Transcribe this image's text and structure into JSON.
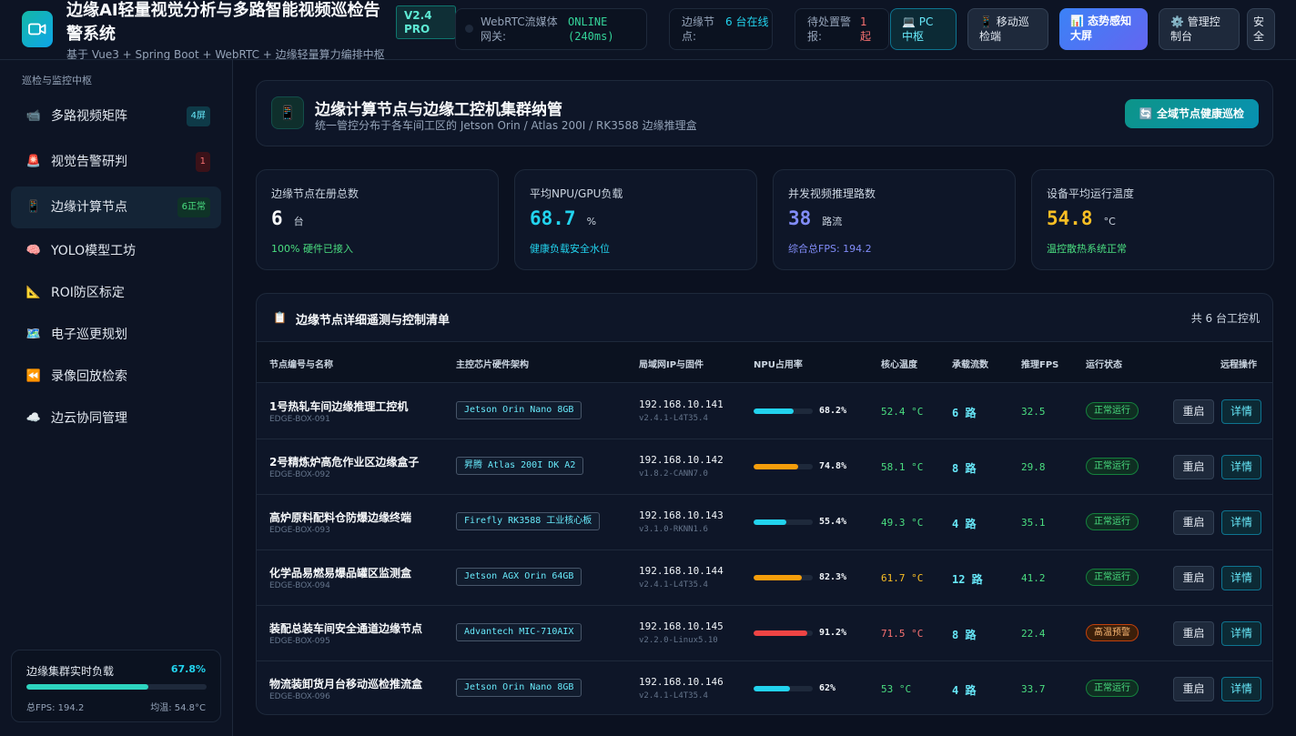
{
  "header": {
    "title": "边缘AI轻量视觉分析与多路智能视频巡检告警系统",
    "subtitle": "基于 Vue3 + Spring Boot + WebRTC + 边缘轻量算力编排中枢",
    "version": "V2.4 PRO",
    "webrtc": {
      "label": "WebRTC流媒体网关:",
      "value": "ONLINE (240ms)"
    },
    "edge_nodes": {
      "label": "边缘节点:",
      "value": "6 台在线"
    },
    "pending": {
      "label": "待处置警报:",
      "value": "1 起"
    },
    "buttons": {
      "pc": "💻 PC 中枢",
      "mobile": "📱 移动巡检端",
      "bigscreen": "📊 态势感知大屏",
      "admin": "⚙️ 管理控制台",
      "security": "安全"
    }
  },
  "sidebar": {
    "section": "巡检与监控中枢",
    "items": [
      {
        "icon": "📹",
        "label": "多路视频矩阵",
        "badge": "4屏"
      },
      {
        "icon": "🚨",
        "label": "视觉告警研判",
        "badge": "1"
      },
      {
        "icon": "📱",
        "label": "边缘计算节点",
        "badge": "6正常"
      },
      {
        "icon": "🧠",
        "label": "YOLO模型工坊",
        "badge": ""
      },
      {
        "icon": "📐",
        "label": "ROI防区标定",
        "badge": ""
      },
      {
        "icon": "🗺️",
        "label": "电子巡更规划",
        "badge": ""
      },
      {
        "icon": "⏪",
        "label": "录像回放检索",
        "badge": ""
      },
      {
        "icon": "☁️",
        "label": "边云协同管理",
        "badge": ""
      }
    ],
    "cluster": {
      "title": "边缘集群实时负载",
      "value": "67.8%",
      "load": 0.678,
      "fps": "总FPS: 194.2",
      "temp": "均温: 54.8°C"
    }
  },
  "section": {
    "icon": "📱",
    "title": "边缘计算节点与边缘工控机集群纳管",
    "subtitle": "统一管控分布于各车间工区的 Jetson Orin / Atlas 200I / RK3588 边缘推理盒",
    "scan_button": "🔄 全域节点健康巡检"
  },
  "kpis": [
    {
      "label": "边缘节点在册总数",
      "value": "6",
      "unit": "台",
      "foot": "100% 硬件已接入",
      "color": "#f8fafc",
      "foot_color": "#4ade80"
    },
    {
      "label": "平均NPU/GPU负载",
      "value": "68.7",
      "unit": "%",
      "foot": "健康负载安全水位",
      "color": "#22d3ee",
      "foot_color": "#22d3ee"
    },
    {
      "label": "并发视频推理路数",
      "value": "38",
      "unit": "路流",
      "foot": "综合总FPS: 194.2",
      "color": "#818cf8",
      "foot_color": "#818cf8"
    },
    {
      "label": "设备平均运行温度",
      "value": "54.8",
      "unit": "°C",
      "foot": "温控散热系统正常",
      "color": "#fbbf24",
      "foot_color": "#4ade80"
    }
  ],
  "table": {
    "icon": "📋",
    "title": "边缘节点详细遥测与控制清单",
    "count": "共 6 台工控机",
    "headers": [
      "节点编号与名称",
      "主控芯片硬件架构",
      "局域网IP与固件",
      "NPU占用率",
      "核心温度",
      "承载流数",
      "推理FPS",
      "运行状态",
      "远程操作"
    ],
    "restart_label": "重启",
    "detail_label": "详情",
    "rows": [
      {
        "name": "1号热轧车间边缘推理工控机",
        "id": "EDGE-BOX-091",
        "chip": "Jetson Orin Nano 8GB",
        "ip": "192.168.10.141",
        "fw": "v2.4.1-L4T35.4",
        "npu": 68.2,
        "npu_label": "68.2%",
        "npu_color": "#22d3ee",
        "temp": "52.4 °C",
        "temp_color": "#4ade80",
        "streams": "6 路",
        "fps": "32.5",
        "status": "正常运行",
        "status_type": "ok"
      },
      {
        "name": "2号精炼炉高危作业区边缘盒子",
        "id": "EDGE-BOX-092",
        "chip": "昇腾 Atlas 200I DK A2",
        "ip": "192.168.10.142",
        "fw": "v1.8.2-CANN7.0",
        "npu": 74.8,
        "npu_label": "74.8%",
        "npu_color": "#f59e0b",
        "temp": "58.1 °C",
        "temp_color": "#4ade80",
        "streams": "8 路",
        "fps": "29.8",
        "status": "正常运行",
        "status_type": "ok"
      },
      {
        "name": "高炉原料配料仓防爆边缘终端",
        "id": "EDGE-BOX-093",
        "chip": "Firefly RK3588 工业核心板",
        "ip": "192.168.10.143",
        "fw": "v3.1.0-RKNN1.6",
        "npu": 55.4,
        "npu_label": "55.4%",
        "npu_color": "#22d3ee",
        "temp": "49.3 °C",
        "temp_color": "#4ade80",
        "streams": "4 路",
        "fps": "35.1",
        "status": "正常运行",
        "status_type": "ok"
      },
      {
        "name": "化学品易燃易爆品罐区监测盒",
        "id": "EDGE-BOX-094",
        "chip": "Jetson AGX Orin 64GB",
        "ip": "192.168.10.144",
        "fw": "v2.4.1-L4T35.4",
        "npu": 82.3,
        "npu_label": "82.3%",
        "npu_color": "#f59e0b",
        "temp": "61.7 °C",
        "temp_color": "#fbbf24",
        "streams": "12 路",
        "fps": "41.2",
        "status": "正常运行",
        "status_type": "ok"
      },
      {
        "name": "装配总装车间安全通道边缘节点",
        "id": "EDGE-BOX-095",
        "chip": "Advantech MIC-710AIX",
        "ip": "192.168.10.145",
        "fw": "v2.2.0-Linux5.10",
        "npu": 91.2,
        "npu_label": "91.2%",
        "npu_color": "#ef4444",
        "temp": "71.5 °C",
        "temp_color": "#f87171",
        "streams": "8 路",
        "fps": "22.4",
        "status": "高温预警",
        "status_type": "warn"
      },
      {
        "name": "物流装卸货月台移动巡检推流盒",
        "id": "EDGE-BOX-096",
        "chip": "Jetson Orin Nano 8GB",
        "ip": "192.168.10.146",
        "fw": "v2.4.1-L4T35.4",
        "npu": 62,
        "npu_label": "62%",
        "npu_color": "#22d3ee",
        "temp": "53 °C",
        "temp_color": "#4ade80",
        "streams": "4 路",
        "fps": "33.7",
        "status": "正常运行",
        "status_type": "ok"
      }
    ]
  }
}
